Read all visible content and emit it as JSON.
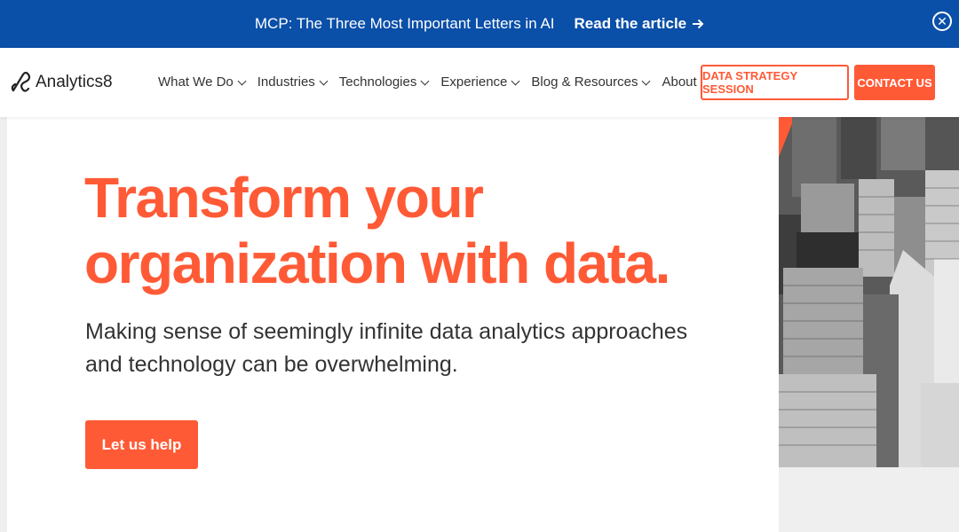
{
  "banner": {
    "message": "MCP: The Three Most Important Letters in AI",
    "cta_label": "Read the article",
    "cta_icon": "arrow-right-icon",
    "close_icon": "close-circle-icon"
  },
  "nav": {
    "logo_text": "Analytics8",
    "items": [
      {
        "label": "What We Do"
      },
      {
        "label": "Industries"
      },
      {
        "label": "Technologies"
      },
      {
        "label": "Experience"
      },
      {
        "label": "Blog & Resources"
      },
      {
        "label": "About Us"
      }
    ],
    "strategy_button": "DATA STRATEGY SESSION",
    "contact_button": "CONTACT US"
  },
  "hero": {
    "headline_line1": "Transform your",
    "headline_line2": "organization with data.",
    "subtext_line1": "Making sense of seemingly infinite data analytics approaches",
    "subtext_line2": "and technology can be overwhelming.",
    "cta_label": "Let us help"
  },
  "colors": {
    "accent": "#ff5a36",
    "banner_bg": "#0a4fa8"
  }
}
